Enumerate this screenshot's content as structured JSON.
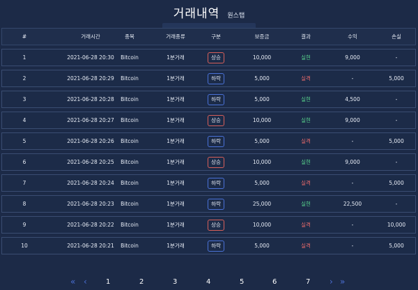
{
  "page": {
    "title": "거래내역",
    "subtitle": "원스탭"
  },
  "columns": [
    "#",
    "거래시간",
    "종목",
    "거래종류",
    "구분",
    "보증금",
    "결과",
    "수익",
    "손실"
  ],
  "rows": [
    {
      "no": "1",
      "time": "2021-06-28 20:30",
      "symbol": "Bitcoin",
      "kind": "1분거래",
      "side": "상승",
      "side_type": "up",
      "deposit": "10,000",
      "result": "실현",
      "result_type": "profit",
      "gain": "9,000",
      "loss": "-"
    },
    {
      "no": "2",
      "time": "2021-06-28 20:29",
      "symbol": "Bitcoin",
      "kind": "1분거래",
      "side": "하락",
      "side_type": "down",
      "deposit": "5,000",
      "result": "실격",
      "result_type": "loss",
      "gain": "-",
      "loss": "5,000"
    },
    {
      "no": "3",
      "time": "2021-06-28 20:28",
      "symbol": "Bitcoin",
      "kind": "1분거래",
      "side": "하락",
      "side_type": "down",
      "deposit": "5,000",
      "result": "실현",
      "result_type": "profit",
      "gain": "4,500",
      "loss": "-"
    },
    {
      "no": "4",
      "time": "2021-06-28 20:27",
      "symbol": "Bitcoin",
      "kind": "1분거래",
      "side": "상승",
      "side_type": "up",
      "deposit": "10,000",
      "result": "실현",
      "result_type": "profit",
      "gain": "9,000",
      "loss": "-"
    },
    {
      "no": "5",
      "time": "2021-06-28 20:26",
      "symbol": "Bitcoin",
      "kind": "1분거래",
      "side": "하락",
      "side_type": "down",
      "deposit": "5,000",
      "result": "실격",
      "result_type": "loss",
      "gain": "-",
      "loss": "5,000"
    },
    {
      "no": "6",
      "time": "2021-06-28 20:25",
      "symbol": "Bitcoin",
      "kind": "1분거래",
      "side": "상승",
      "side_type": "up",
      "deposit": "10,000",
      "result": "실현",
      "result_type": "profit",
      "gain": "9,000",
      "loss": "-"
    },
    {
      "no": "7",
      "time": "2021-06-28 20:24",
      "symbol": "Bitcoin",
      "kind": "1분거래",
      "side": "하락",
      "side_type": "down",
      "deposit": "5,000",
      "result": "실격",
      "result_type": "loss",
      "gain": "-",
      "loss": "5,000"
    },
    {
      "no": "8",
      "time": "2021-06-28 20:23",
      "symbol": "Bitcoin",
      "kind": "1분거래",
      "side": "하락",
      "side_type": "down",
      "deposit": "25,000",
      "result": "실현",
      "result_type": "profit",
      "gain": "22,500",
      "loss": "-"
    },
    {
      "no": "9",
      "time": "2021-06-28 20:22",
      "symbol": "Bitcoin",
      "kind": "1분거래",
      "side": "상승",
      "side_type": "up",
      "deposit": "10,000",
      "result": "실격",
      "result_type": "loss",
      "gain": "-",
      "loss": "10,000"
    },
    {
      "no": "10",
      "time": "2021-06-28 20:21",
      "symbol": "Bitcoin",
      "kind": "1분거래",
      "side": "하락",
      "side_type": "down",
      "deposit": "5,000",
      "result": "실격",
      "result_type": "loss",
      "gain": "-",
      "loss": "5,000"
    }
  ],
  "pagination": {
    "first": "«",
    "prev": "‹",
    "pages": [
      "1",
      "2",
      "3",
      "4",
      "5",
      "6",
      "7"
    ],
    "next": "›",
    "last": "»"
  },
  "colors": {
    "background": "#1c2a47",
    "profit": "#57d38c",
    "loss": "#e96a6a",
    "badge_up": "#d8605a",
    "badge_down": "#4a72d8",
    "pager_arrow": "#4b6fd4"
  },
  "icons": {
    "first": "double-chevron-left-icon",
    "prev": "chevron-left-icon",
    "next": "chevron-right-icon",
    "last": "double-chevron-right-icon"
  }
}
